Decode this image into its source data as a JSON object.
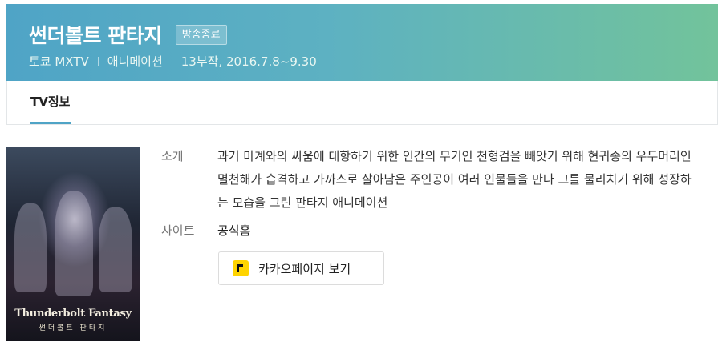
{
  "header": {
    "title": "썬더볼트 판타지",
    "status_badge": "방송종료",
    "meta": [
      "토쿄 MXTV",
      "애니메이션",
      "13부작, 2016.7.8~9.30"
    ],
    "gradient_start": "#4fa4c6",
    "gradient_end": "#72c39b"
  },
  "tabs": [
    {
      "label": "TV정보",
      "active": true
    }
  ],
  "poster": {
    "title_en": "Thunderbolt Fantasy",
    "title_ko": "썬더볼트 판타지"
  },
  "info": {
    "synopsis_label": "소개",
    "synopsis": "과거 마계와의 싸움에 대항하기 위한 인간의 무기인 천형검을 빼앗기 위해 현귀종의 우두머리인 멸천해가 습격하고 가까스로 살아남은 주인공이 여러 인물들을 만나 그를 물리치기 위해 성장하는 모습을 그린 판타지 애니메이션",
    "site_label": "사이트",
    "site_link": "공식홈"
  },
  "actions": {
    "kakao_label": "카카오페이지 보기",
    "kakao_icon": "kakaopage-icon",
    "kakao_color": "#ffd400"
  }
}
